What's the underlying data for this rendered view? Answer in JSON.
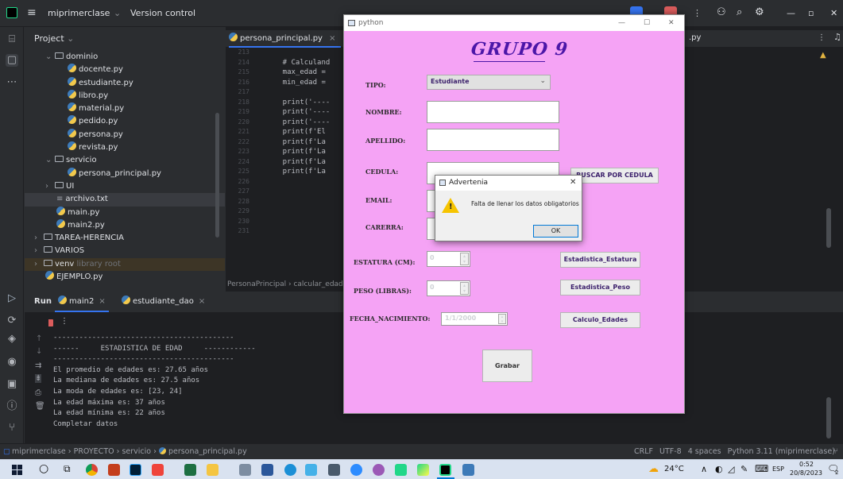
{
  "ide": {
    "project_name": "miprimerclase",
    "vcs_label": "Version control",
    "project_panel_title": "Project",
    "tree": [
      {
        "label": "dominio",
        "kind": "folder",
        "indent": 1,
        "open": true
      },
      {
        "label": "docente.py",
        "kind": "py",
        "indent": 3
      },
      {
        "label": "estudiante.py",
        "kind": "py",
        "indent": 3
      },
      {
        "label": "libro.py",
        "kind": "py",
        "indent": 3
      },
      {
        "label": "material.py",
        "kind": "py",
        "indent": 3
      },
      {
        "label": "pedido.py",
        "kind": "py",
        "indent": 3
      },
      {
        "label": "persona.py",
        "kind": "py",
        "indent": 3
      },
      {
        "label": "revista.py",
        "kind": "py",
        "indent": 3
      },
      {
        "label": "servicio",
        "kind": "folder",
        "indent": 1,
        "open": true
      },
      {
        "label": "persona_principal.py",
        "kind": "py",
        "indent": 3
      },
      {
        "label": "UI",
        "kind": "folder",
        "indent": 1,
        "open": false
      },
      {
        "label": "archivo.txt",
        "kind": "txt",
        "indent": 2
      },
      {
        "label": "main.py",
        "kind": "py",
        "indent": 2
      },
      {
        "label": "main2.py",
        "kind": "py",
        "indent": 2
      },
      {
        "label": "TAREA-HERENCIA",
        "kind": "folder",
        "indent": 0,
        "open": false
      },
      {
        "label": "VARIOS",
        "kind": "folder",
        "indent": 0,
        "open": false
      },
      {
        "label": "venv",
        "kind": "folder",
        "indent": 0,
        "open": false,
        "extra": "library root"
      },
      {
        "label": "EJEMPLO.py",
        "kind": "py",
        "indent": 1
      }
    ],
    "editor_tab": "persona_principal.py",
    "editor_tab_right": ".py",
    "line_numbers": [
      "213",
      "214",
      "215",
      "216",
      "217",
      "218",
      "219",
      "220",
      "221",
      "222",
      "223",
      "224",
      "225",
      "226",
      "227",
      "228",
      "229",
      "230",
      "231"
    ],
    "code_lines": [
      "",
      "    # Calculand",
      "    max_edad =",
      "    min_edad =",
      "",
      "    print('----",
      "    print('----",
      "    print('----",
      "    print(f'El",
      "    print(f'La",
      "    print(f'La",
      "    print(f'La",
      "    print(f'La",
      "",
      "",
      "",
      "",
      "",
      ""
    ],
    "breadcrumb_class": "PersonaPrincipal",
    "breadcrumb_method": "calcular_edad(",
    "run_label": "Run",
    "run_tabs": [
      "main2",
      "estudiante_dao"
    ],
    "output_lines": [
      "------------------------------------------",
      "------     ESTADISTICA DE EDAD     ------------",
      "------------------------------------------",
      "El promedio de edades es: 27.65 años",
      "La mediana de edades es: 27.5 años",
      "La moda de edades es: [23, 24]",
      "La edad máxima es: 37 años",
      "La edad mínima es: 22 años",
      "Completar datos"
    ],
    "status_breadcrumb": [
      "miprimerclase",
      "PROYECTO",
      "servicio",
      "persona_principal.py"
    ],
    "status_right": [
      "CRLF",
      "UTF-8",
      "4 spaces",
      "Python 3.11 (miprimerclase)"
    ]
  },
  "app": {
    "window_title": "python",
    "heading": "GRUPO 9",
    "fields": {
      "tipo_label": "TIPO:",
      "tipo_value": "Estudiante",
      "nombre_label": "NOMBRE:",
      "apellido_label": "APELLIDO:",
      "cedula_label": "CEDULA:",
      "email_label": "EMAIL:",
      "carrera_label": "CARERRA:",
      "estatura_label": "ESTATURA (CM):",
      "estatura_value": "0",
      "peso_label": "PESO (LIBRAS):",
      "peso_value": "0",
      "fecha_label": "FECHA_NACIMIENTO:",
      "fecha_value": "1/1/2000"
    },
    "buttons": {
      "buscar": "BUSCAR POR CEDULA",
      "estatura": "Estadistica_Estatura",
      "peso": "Estadistica_Peso",
      "edades": "Calculo_Edades",
      "grabar": "Grabar"
    }
  },
  "dialog": {
    "title": "Advertenia",
    "message": "Falta de llenar los datos obligatorios",
    "ok": "OK"
  },
  "taskbar": {
    "weather": "24°C",
    "lang": "ESP",
    "time": "0:52",
    "date": "20/8/2023",
    "notif_count": "2"
  }
}
